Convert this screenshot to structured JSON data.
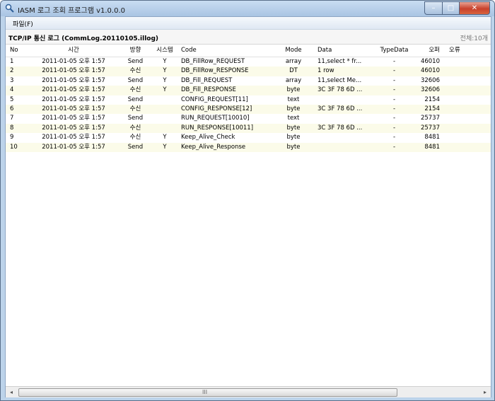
{
  "window": {
    "title": "IASM 로그 조회 프로그램 v1.0.0.0",
    "controls": {
      "minimize": "–",
      "maximize": "□",
      "close": "✕"
    }
  },
  "menu": {
    "file": "파일(F)"
  },
  "section": {
    "title": "TCP/IP 통신 로그 (CommLog.20110105.illog)",
    "total": "전체:10개"
  },
  "table": {
    "headers": [
      "No",
      "시간",
      "방향",
      "시스템",
      "Code",
      "Mode",
      "Data",
      "TypeData",
      "오퍼",
      "오류"
    ],
    "rows": [
      {
        "no": "1",
        "time": "2011-01-05 오후 1:57",
        "dir": "Send",
        "sys": "Y",
        "code": "DB_FillRow_REQUEST",
        "mode": "array",
        "data": "11,select * fr...",
        "type": "-",
        "size": "46010",
        "err": ""
      },
      {
        "no": "2",
        "time": "2011-01-05 오후 1:57",
        "dir": "수신",
        "sys": "Y",
        "code": "DB_FillRow_RESPONSE",
        "mode": "DT",
        "data": "1 row",
        "type": "-",
        "size": "46010",
        "err": ""
      },
      {
        "no": "3",
        "time": "2011-01-05 오후 1:57",
        "dir": "Send",
        "sys": "Y",
        "code": "DB_Fill_REQUEST",
        "mode": "array",
        "data": "11,select Me...",
        "type": "-",
        "size": "32606",
        "err": ""
      },
      {
        "no": "4",
        "time": "2011-01-05 오후 1:57",
        "dir": "수신",
        "sys": "Y",
        "code": "DB_Fill_RESPONSE",
        "mode": "byte",
        "data": "3C 3F 78 6D ...",
        "type": "-",
        "size": "32606",
        "err": ""
      },
      {
        "no": "5",
        "time": "2011-01-05 오후 1:57",
        "dir": "Send",
        "sys": "",
        "code": "CONFIG_REQUEST[11]",
        "mode": "text",
        "data": "",
        "type": "-",
        "size": "2154",
        "err": ""
      },
      {
        "no": "6",
        "time": "2011-01-05 오후 1:57",
        "dir": "수신",
        "sys": "",
        "code": "CONFIG_RESPONSE[12]",
        "mode": "byte",
        "data": "3C 3F 78 6D ...",
        "type": "-",
        "size": "2154",
        "err": ""
      },
      {
        "no": "7",
        "time": "2011-01-05 오후 1:57",
        "dir": "Send",
        "sys": "",
        "code": "RUN_REQUEST[10010]",
        "mode": "text",
        "data": "",
        "type": "-",
        "size": "25737",
        "err": ""
      },
      {
        "no": "8",
        "time": "2011-01-05 오후 1:57",
        "dir": "수신",
        "sys": "",
        "code": "RUN_RESPONSE[10011]",
        "mode": "byte",
        "data": "3C 3F 78 6D ...",
        "type": "-",
        "size": "25737",
        "err": ""
      },
      {
        "no": "9",
        "time": "2011-01-05 오후 1:57",
        "dir": "수신",
        "sys": "Y",
        "code": "Keep_Alive_Check",
        "mode": "byte",
        "data": "",
        "type": "-",
        "size": "8481",
        "err": ""
      },
      {
        "no": "10",
        "time": "2011-01-05 오후 1:57",
        "dir": "Send",
        "sys": "Y",
        "code": "Keep_Alive_Response",
        "mode": "byte",
        "data": "",
        "type": "-",
        "size": "8481",
        "err": ""
      }
    ]
  },
  "scrollbar": {
    "left_arrow": "◂",
    "right_arrow": "▸",
    "grip": "III"
  },
  "colors": {
    "row_alt": "#fbfbe9",
    "title_bar": "#bcd3ea",
    "close_button": "#c8412c"
  }
}
